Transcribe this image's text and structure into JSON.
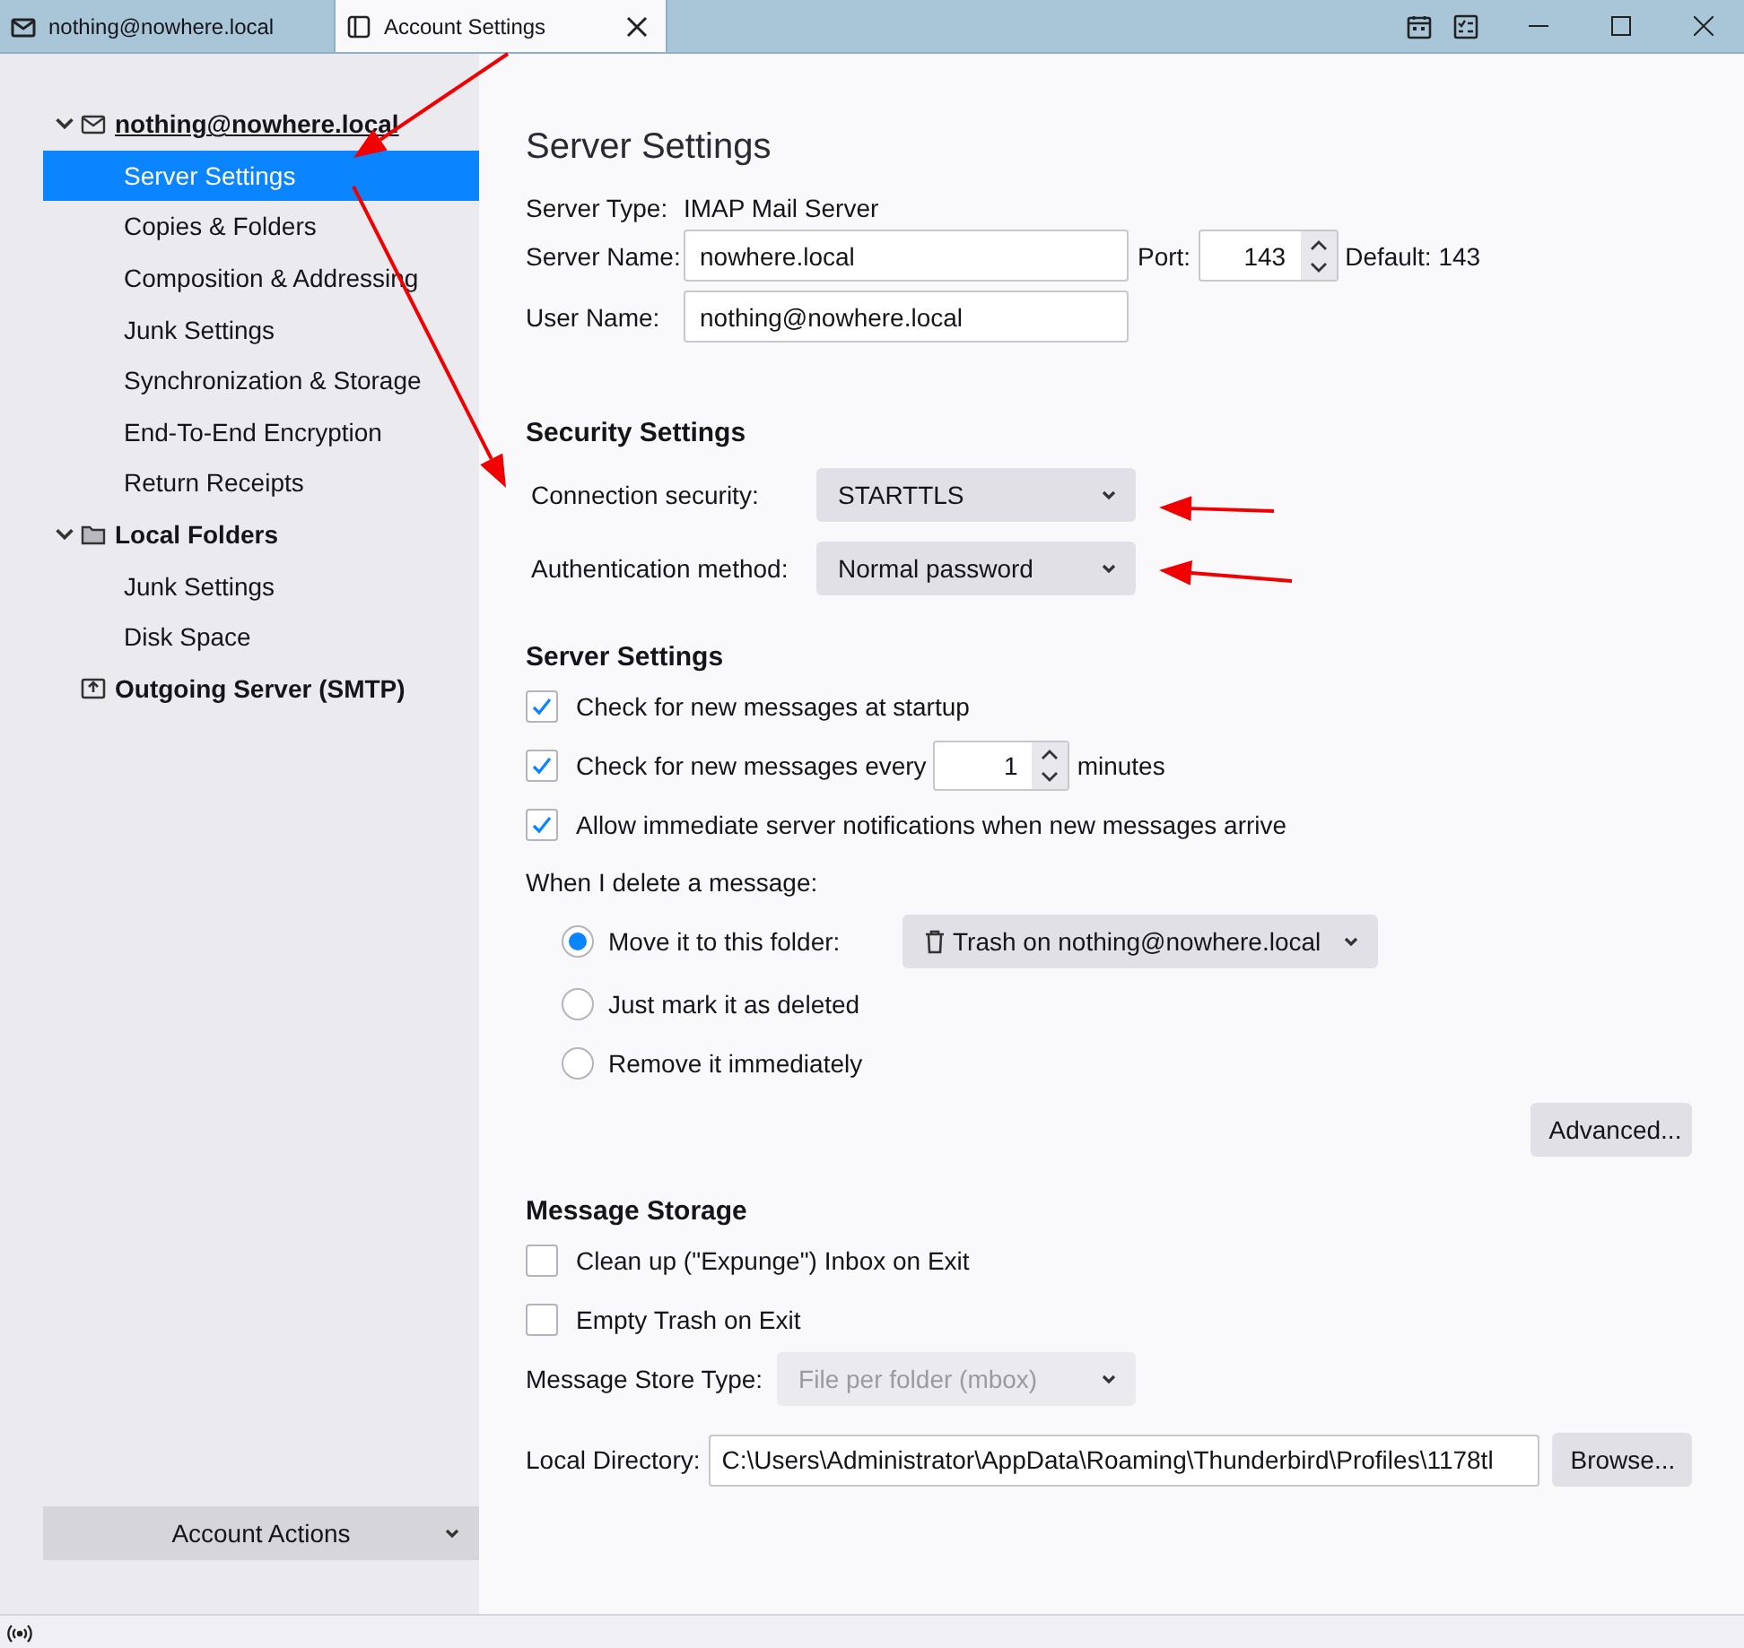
{
  "tabs": [
    {
      "label": "nothing@nowhere.local",
      "selected": false
    },
    {
      "label": "Account Settings",
      "selected": true
    }
  ],
  "sidebar": {
    "items": [
      {
        "label": "nothing@nowhere.local",
        "kind": "account",
        "expanded": true,
        "current": true,
        "children": [
          {
            "label": "Server Settings",
            "selected": true
          },
          {
            "label": "Copies & Folders",
            "selected": false
          },
          {
            "label": "Composition & Addressing",
            "selected": false
          },
          {
            "label": "Junk Settings",
            "selected": false
          },
          {
            "label": "Synchronization & Storage",
            "selected": false
          },
          {
            "label": "End-To-End Encryption",
            "selected": false
          },
          {
            "label": "Return Receipts",
            "selected": false
          }
        ]
      },
      {
        "label": "Local Folders",
        "kind": "account",
        "expanded": true,
        "current": false,
        "children": [
          {
            "label": "Junk Settings",
            "selected": false
          },
          {
            "label": "Disk Space",
            "selected": false
          }
        ]
      },
      {
        "label": "Outgoing Server (SMTP)",
        "kind": "smtp",
        "current": false
      }
    ],
    "account_actions": "Account Actions"
  },
  "content": {
    "title": "Server Settings",
    "server_type": {
      "label": "Server Type:",
      "value": "IMAP Mail Server"
    },
    "server_name": {
      "label": "Server Name:",
      "value": "nowhere.local"
    },
    "port": {
      "label": "Port:",
      "value": "143",
      "default": "Default: 143"
    },
    "user_name": {
      "label": "User Name:",
      "value": "nothing@nowhere.local"
    },
    "security": {
      "heading": "Security Settings",
      "rows": [
        {
          "label": "Connection security:",
          "value": "STARTTLS"
        },
        {
          "label": "Authentication method:",
          "value": "Normal password"
        }
      ]
    },
    "server_settings": {
      "heading": "Server Settings",
      "checks": [
        {
          "kind": "check",
          "label": "Check for new messages at startup",
          "checked": true
        },
        {
          "kind": "interval",
          "label": "Check for new messages every",
          "value": "1",
          "suffix": "minutes",
          "checked": true
        },
        {
          "kind": "check",
          "label": "Allow immediate server notifications when new messages arrive",
          "checked": true
        }
      ],
      "delete_label": "When I delete a message:",
      "delete_options": [
        {
          "label": "Move it to this folder:",
          "selected": true,
          "folder": "Trash on nothing@nowhere.local"
        },
        {
          "label": "Just mark it as deleted",
          "selected": false
        },
        {
          "label": "Remove it immediately",
          "selected": false
        }
      ],
      "advanced_button": "Advanced..."
    },
    "storage": {
      "heading": "Message Storage",
      "checks": [
        {
          "kind": "check",
          "label": "Clean up (\"Expunge\") Inbox on Exit",
          "checked": false
        },
        {
          "kind": "check",
          "label": "Empty Trash on Exit",
          "checked": false
        }
      ],
      "store_type": {
        "label": "Message Store Type:",
        "value": "File per folder (mbox)",
        "disabled": true
      },
      "local_directory": {
        "label": "Local Directory:",
        "value": "C:\\Users\\Administrator\\AppData\\Roaming\\Thunderbird\\Profiles\\1178tl"
      },
      "browse_button": "Browse..."
    }
  },
  "annotations": [
    {
      "kind": "arrow"
    },
    {
      "kind": "arrow"
    },
    {
      "kind": "arrow"
    },
    {
      "kind": "arrow"
    }
  ]
}
